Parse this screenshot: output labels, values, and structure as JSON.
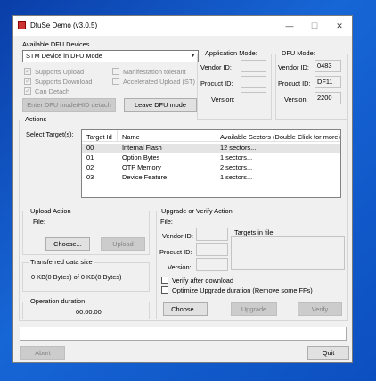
{
  "window": {
    "title": "DfuSe Demo (v3.0.5)",
    "minimize": "—",
    "maximize": "☐",
    "close": "✕"
  },
  "dfu_devices": {
    "group_label": "Available DFU Devices",
    "selected_device": "STM Device in DFU Mode",
    "supports_upload": "Supports Upload",
    "supports_download": "Supports Download",
    "can_detach": "Can Detach",
    "manifestation_tolerant": "Manifestation tolerant",
    "accelerated_upload": "Accelerated Upload (ST)",
    "enter_dfu_button": "Enter DFU mode/HID detach",
    "leave_dfu_button": "Leave DFU mode"
  },
  "application_mode": {
    "group_label": "Application Mode:",
    "vendor_id_label": "Vendor ID:",
    "product_id_label": "Procuct ID:",
    "version_label": "Version:",
    "vendor_id": "",
    "product_id": "",
    "version": ""
  },
  "dfu_mode": {
    "group_label": "DFU Mode:",
    "vendor_id_label": "Vendor ID:",
    "product_id_label": "Procuct ID:",
    "version_label": "Version:",
    "vendor_id": "0483",
    "product_id": "DF11",
    "version": "2200"
  },
  "actions": {
    "group_label": "Actions",
    "select_targets_label": "Select Target(s):",
    "table": {
      "headers": [
        "Target Id",
        "Name",
        "Available Sectors (Double Click for more)"
      ],
      "rows": [
        [
          "00",
          "Internal Flash",
          "12 sectors..."
        ],
        [
          "01",
          "Option Bytes",
          "1 sectors..."
        ],
        [
          "02",
          "OTP Memory",
          "2 sectors..."
        ],
        [
          "03",
          "Device Feature",
          "1 sectors..."
        ]
      ]
    }
  },
  "upload_action": {
    "group_label": "Upload Action",
    "file_label": "File:",
    "choose_button": "Choose...",
    "upload_button": "Upload"
  },
  "transferred": {
    "group_label": "Transferred data size",
    "value": "0 KB(0 Bytes) of 0 KB(0 Bytes)"
  },
  "operation": {
    "group_label": "Operation duration",
    "value": "00:00:00"
  },
  "upgrade_verify": {
    "group_label": "Upgrade or Verify Action",
    "file_label": "File:",
    "vendor_id_label": "Vendor ID:",
    "product_id_label": "Procuct ID:",
    "version_label": "Version:",
    "targets_in_file_label": "Targets in file:",
    "verify_after_download": "Verify after download",
    "optimize_upgrade": "Optimize Upgrade duration (Remove some FFs)",
    "choose_button": "Choose...",
    "upgrade_button": "Upgrade",
    "verify_button": "Verify"
  },
  "footer": {
    "abort_button": "Abort",
    "quit_button": "Quit"
  },
  "icons": {
    "app": "dfuse-app-icon",
    "dropdown": "chevron-down-icon"
  }
}
